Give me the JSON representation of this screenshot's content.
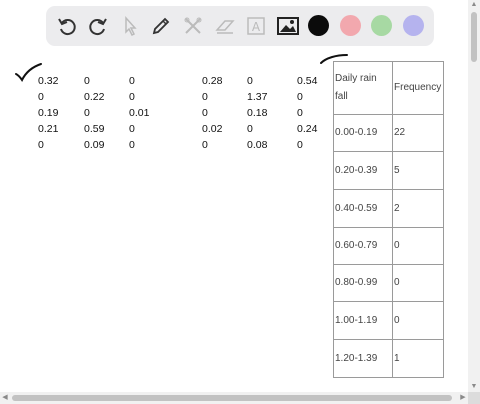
{
  "toolbar": {
    "tools": [
      "undo-icon",
      "redo-icon",
      "pointer-icon",
      "pen-icon",
      "tools-icon",
      "eraser-icon",
      "text-icon",
      "image-icon"
    ],
    "colors": [
      "#0b0b0b",
      "#f2a8ae",
      "#a7d9a3",
      "#b5b3ee"
    ]
  },
  "data_rows": [
    [
      "0.32",
      "0",
      "0",
      "0.28",
      "0",
      "0.54"
    ],
    [
      "0",
      "0.22",
      "0",
      "0",
      "1.37",
      "0"
    ],
    [
      "0.19",
      "0",
      "0.01",
      "0",
      "0.18",
      "0"
    ],
    [
      "0.21",
      "0.59",
      "0",
      "0.02",
      "0",
      "0.24"
    ],
    [
      "0",
      "0.09",
      "0",
      "0",
      "0.08",
      "0"
    ]
  ],
  "freq_table": {
    "headers": [
      "Daily rain fall",
      "Frequency"
    ],
    "rows": [
      [
        "0.00-0.19",
        "22"
      ],
      [
        "0.20-0.39",
        "5"
      ],
      [
        "0.40-0.59",
        "2"
      ],
      [
        "0.60-0.79",
        "0"
      ],
      [
        "0.80-0.99",
        "0"
      ],
      [
        "1.00-1.19",
        "0"
      ],
      [
        "1.20-1.39",
        "1"
      ]
    ]
  }
}
